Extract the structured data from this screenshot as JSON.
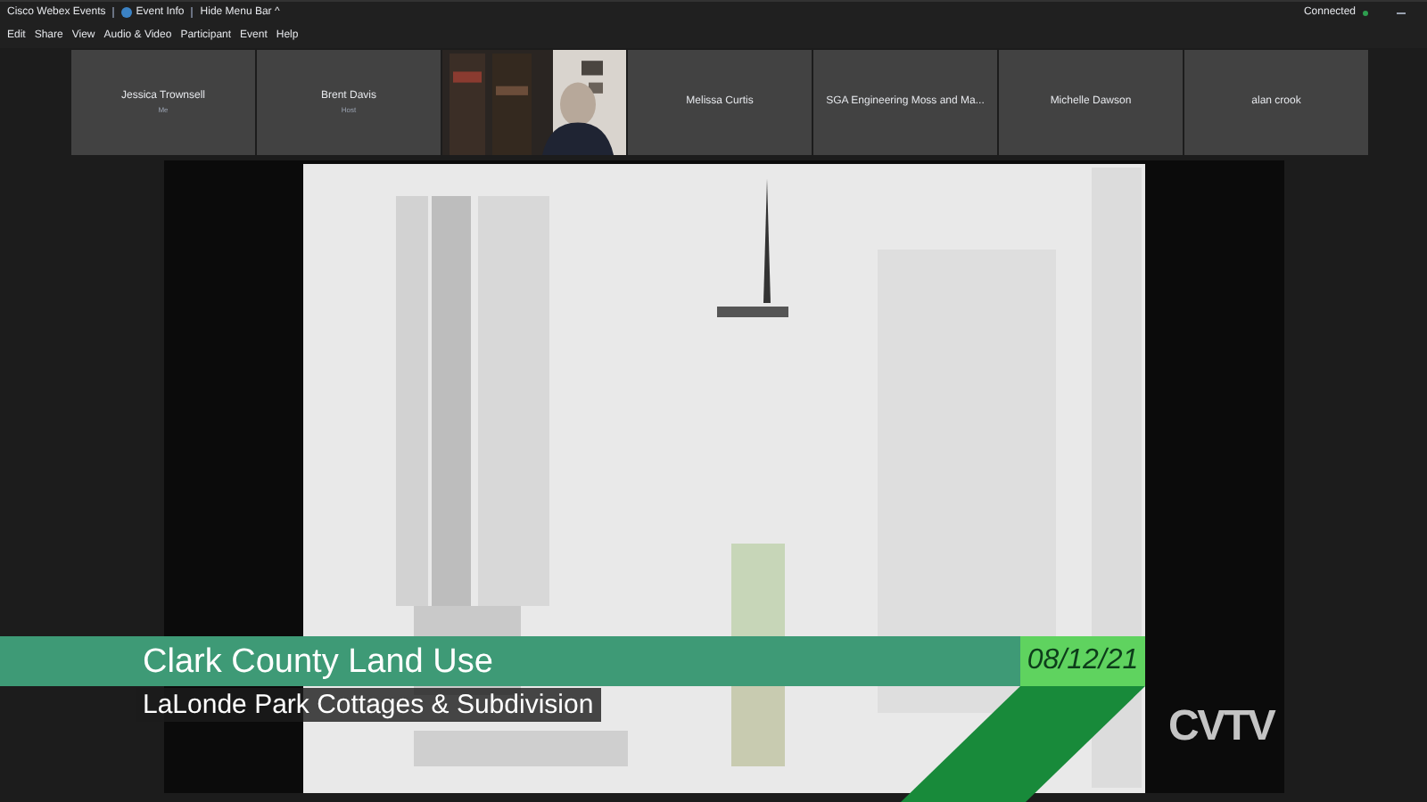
{
  "title_bar": {
    "app": "Cisco Webex Events",
    "event_info": "Event Info",
    "hide_menu": "Hide Menu Bar",
    "hide_menu_icon": "^",
    "status": "Connected"
  },
  "menu": [
    "Edit",
    "Share",
    "View",
    "Audio & Video",
    "Participant",
    "Event",
    "Help"
  ],
  "participants": [
    {
      "kind": "name",
      "name": "Jessica Trownsell",
      "role": "Me"
    },
    {
      "kind": "name",
      "name": "Brent Davis",
      "role": "Host"
    },
    {
      "kind": "video"
    },
    {
      "kind": "name",
      "name": "Melissa Curtis"
    },
    {
      "kind": "name",
      "name": "SGA Engineering Moss and Ma..."
    },
    {
      "kind": "name",
      "name": "Michelle Dawson"
    },
    {
      "kind": "name",
      "name": "alan crook"
    }
  ],
  "lower_third": {
    "title": "Clark County Land Use",
    "subtitle": "LaLonde Park Cottages & Subdivision",
    "date": "08/12/21",
    "channel": "CVTV"
  }
}
